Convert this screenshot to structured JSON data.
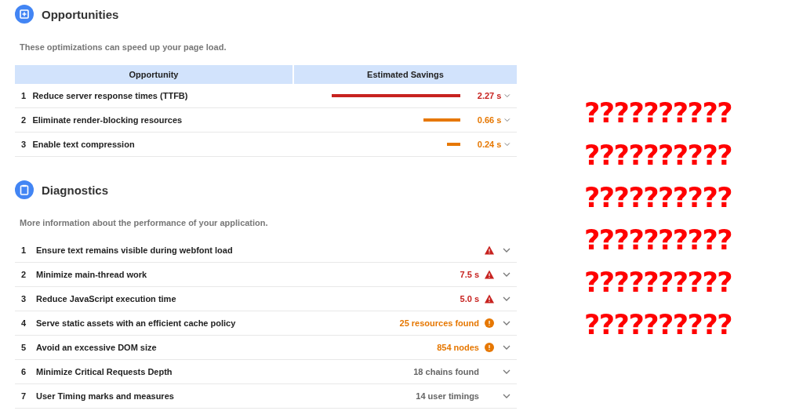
{
  "opportunities": {
    "title": "Opportunities",
    "description": "These optimizations can speed up your page load.",
    "columns": [
      "Opportunity",
      "Estimated Savings"
    ],
    "rows": [
      {
        "index": "1",
        "title": "Reduce server response times (TTFB)",
        "savings": "2.27 s",
        "kind": "fail"
      },
      {
        "index": "2",
        "title": "Eliminate render-blocking resources",
        "savings": "0.66 s",
        "kind": "average"
      },
      {
        "index": "3",
        "title": "Enable text compression",
        "savings": "0.24 s",
        "kind": "average"
      }
    ]
  },
  "diagnostics": {
    "title": "Diagnostics",
    "description": "More information about the performance of your application.",
    "rows": [
      {
        "index": "1",
        "title": "Ensure text remains visible during webfont load",
        "kind": "fail"
      },
      {
        "index": "2",
        "title": "Minimize main-thread work",
        "value": "7.5 s",
        "kind": "fail"
      },
      {
        "index": "3",
        "title": "Reduce JavaScript execution time",
        "value": "5.0 s",
        "kind": "fail"
      },
      {
        "index": "4",
        "title": "Serve static assets with an efficient cache policy",
        "value": "25 resources found",
        "kind": "average"
      },
      {
        "index": "5",
        "title": "Avoid an excessive DOM size",
        "value": "854 nodes",
        "kind": "average"
      },
      {
        "index": "6",
        "title": "Minimize Critical Requests Depth",
        "value": "18 chains found",
        "kind": "info"
      },
      {
        "index": "7",
        "title": "User Timing marks and measures",
        "value": "14 user timings",
        "kind": "info"
      }
    ]
  },
  "question_marks": [
    "??????????",
    "??????????",
    "??????????",
    "??????????",
    "??????????",
    "??????????"
  ]
}
